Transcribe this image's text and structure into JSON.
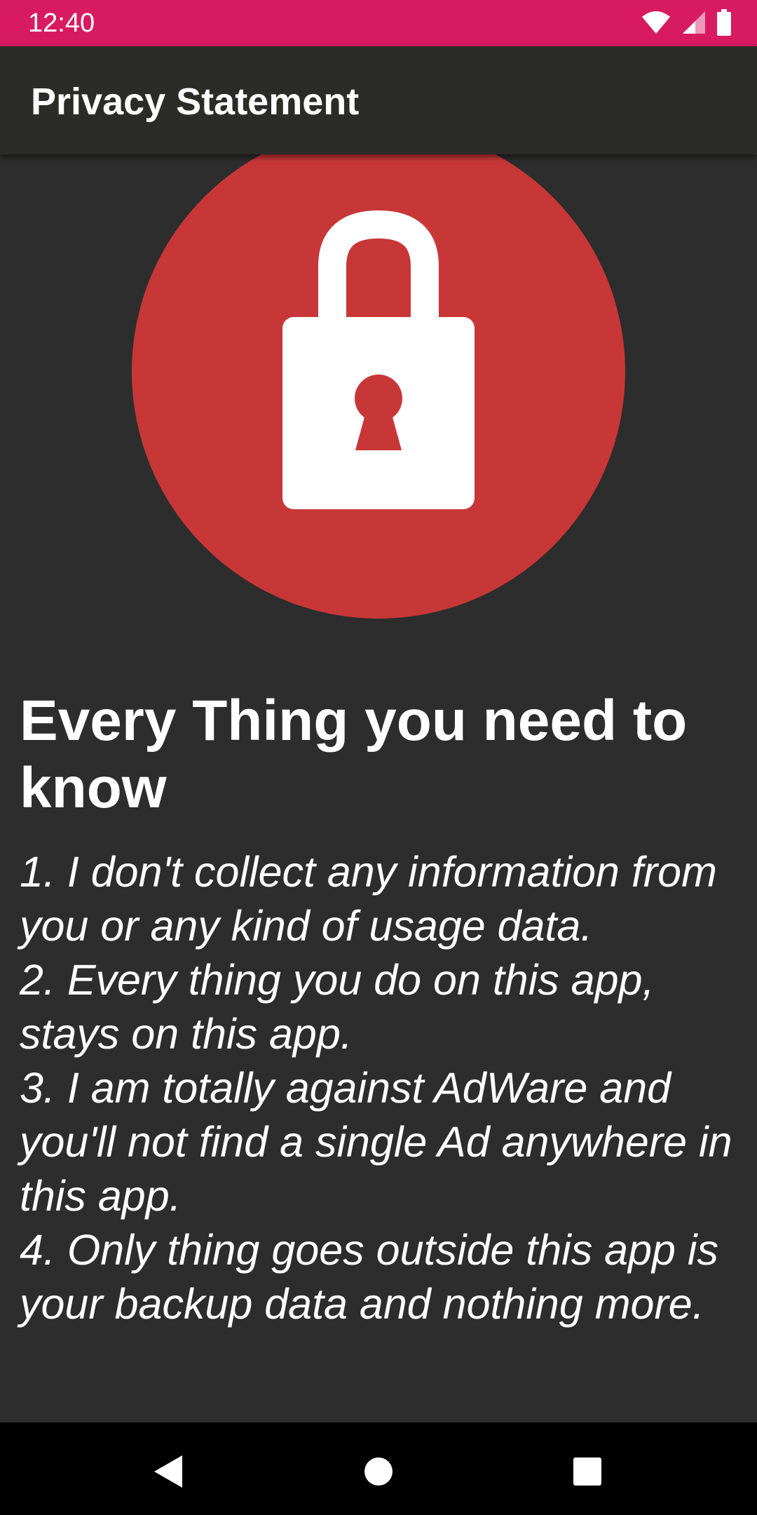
{
  "status_bar": {
    "time": "12:40",
    "color": "#d81b60",
    "icons": [
      "wifi-icon",
      "signal-icon",
      "battery-icon"
    ]
  },
  "app_bar": {
    "title": "Privacy Statement",
    "color": "#2b2b28"
  },
  "hero": {
    "icon": "lock-icon",
    "circle_color": "#c83737"
  },
  "content": {
    "heading": "Every Thing you need to know",
    "body": "1. I don't collect any information from you or any kind of usage data.\n 2. Every thing you do on this app, stays on this app.\n 3. I am totally against AdWare and you'll not find a single Ad anywhere in this app.\n 4. Only thing goes outside this app is your backup data and nothing more."
  },
  "nav_bar": {
    "buttons": [
      "back-icon",
      "home-icon",
      "recents-icon"
    ]
  }
}
